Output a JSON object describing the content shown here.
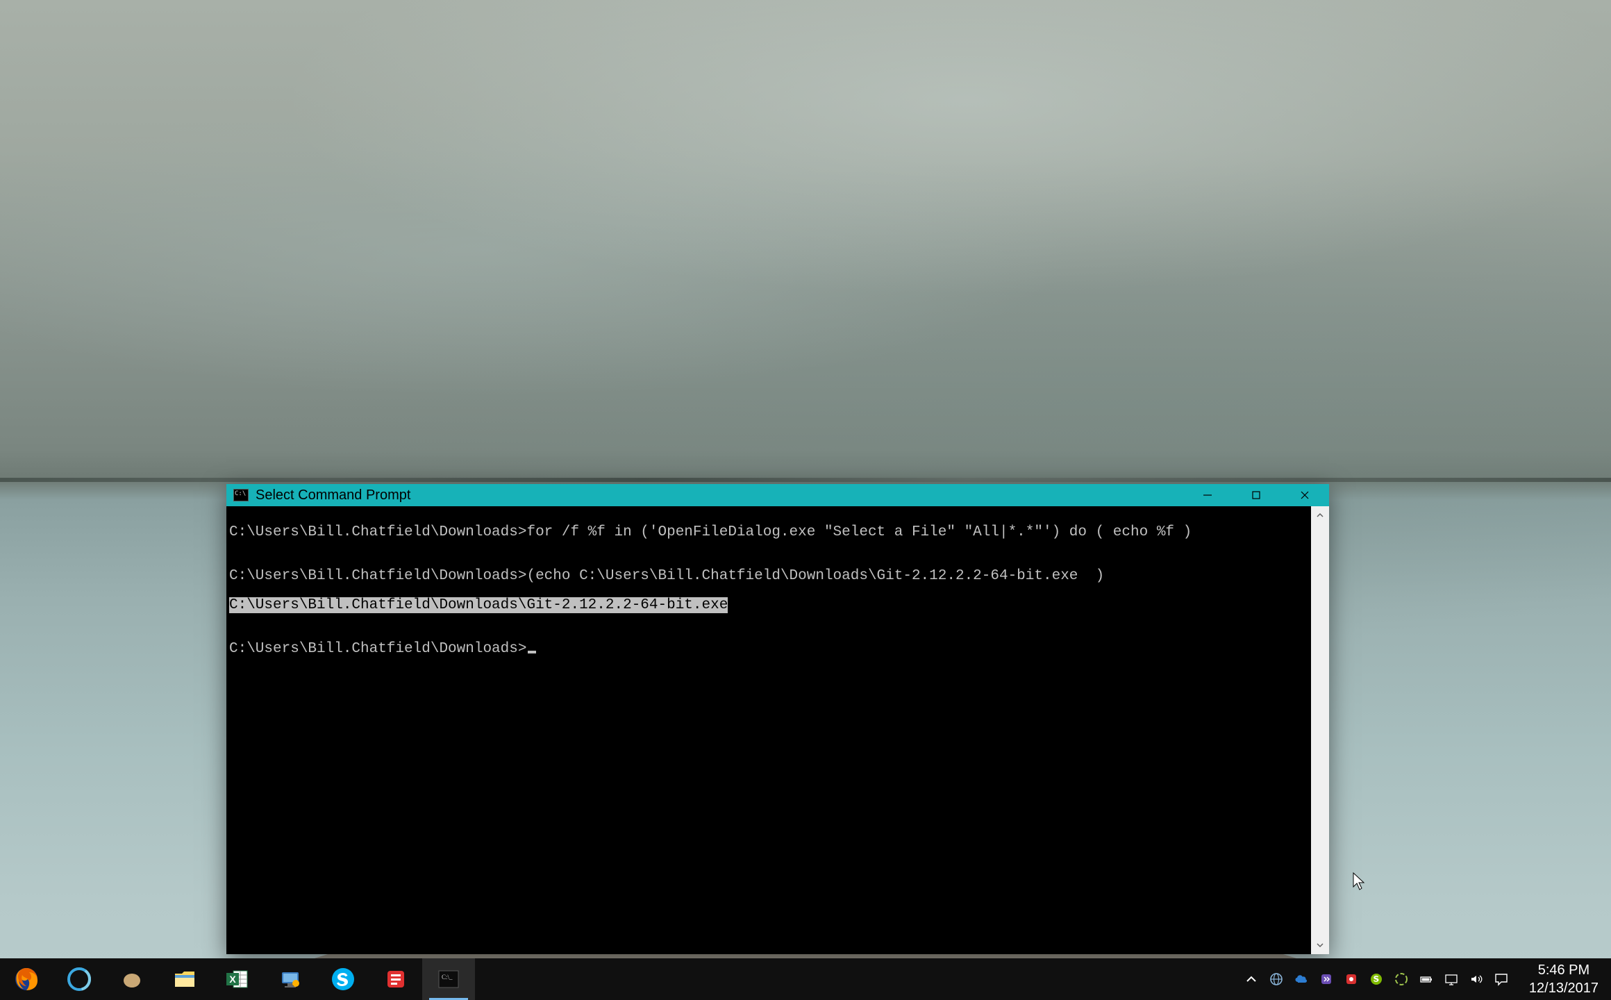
{
  "window": {
    "title": "Select Command Prompt",
    "lines": {
      "l1": "C:\\Users\\Bill.Chatfield\\Downloads>for /f %f in ('OpenFileDialog.exe \"Select a File\" \"All|*.*\"') do ( echo %f )",
      "blank1": "",
      "l2": "C:\\Users\\Bill.Chatfield\\Downloads>(echo C:\\Users\\Bill.Chatfield\\Downloads\\Git-2.12.2.2-64-bit.exe  )",
      "l3_highlight": "C:\\Users\\Bill.Chatfield\\Downloads\\Git-2.12.2.2-64-bit.exe",
      "blank2": "",
      "prompt": "C:\\Users\\Bill.Chatfield\\Downloads>"
    }
  },
  "taskbar": {
    "apps": [
      {
        "name": "firefox"
      },
      {
        "name": "cortana"
      },
      {
        "name": "app-beige"
      },
      {
        "name": "file-explorer"
      },
      {
        "name": "excel"
      },
      {
        "name": "remote-desktop"
      },
      {
        "name": "skype"
      },
      {
        "name": "notifications-red"
      },
      {
        "name": "command-prompt"
      }
    ],
    "tray": [
      {
        "name": "show-hidden-icons"
      },
      {
        "name": "globe"
      },
      {
        "name": "onedrive"
      },
      {
        "name": "app-purple"
      },
      {
        "name": "app-red"
      },
      {
        "name": "skype-tray"
      },
      {
        "name": "app-green"
      },
      {
        "name": "battery"
      },
      {
        "name": "monitor"
      },
      {
        "name": "volume"
      },
      {
        "name": "action-center"
      }
    ],
    "time": "5:46 PM",
    "date": "12/13/2017"
  }
}
